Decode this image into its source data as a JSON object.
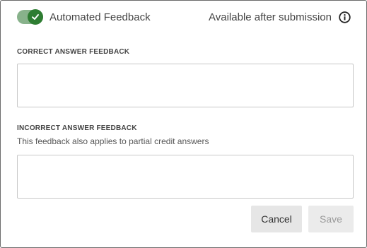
{
  "header": {
    "toggle_label": "Automated Feedback",
    "toggle_on": true,
    "availability_text": "Available after submission"
  },
  "correct": {
    "label": "CORRECT ANSWER FEEDBACK",
    "value": ""
  },
  "incorrect": {
    "label": "INCORRECT ANSWER FEEDBACK",
    "helper": "This feedback also applies to partial credit answers",
    "value": ""
  },
  "actions": {
    "cancel_label": "Cancel",
    "save_label": "Save"
  },
  "colors": {
    "toggle_track": "#88b28b",
    "toggle_knob": "#2e7d32"
  },
  "icons": {
    "toggle": "check-icon",
    "info": "info-icon"
  }
}
